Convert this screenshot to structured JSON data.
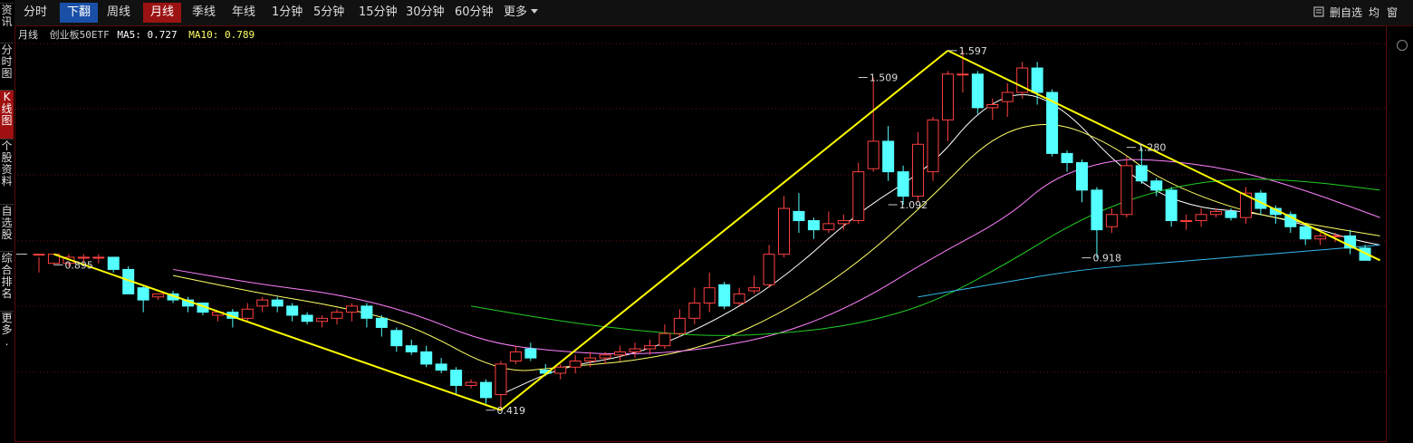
{
  "sidebar": [
    {
      "label": "资讯",
      "active": false
    },
    {
      "label": "分时图",
      "active": false
    },
    {
      "label": "K线图",
      "active": true
    },
    {
      "label": "个股资料",
      "active": false
    },
    {
      "label": "自选股",
      "active": false
    },
    {
      "label": "综合排名",
      "active": false
    },
    {
      "label": "更多.",
      "active": false
    }
  ],
  "tabs": [
    {
      "label": "分时",
      "style": "plain"
    },
    {
      "label": "下翻",
      "style": "blue"
    },
    {
      "label": "周线",
      "style": "plain"
    },
    {
      "label": "月线",
      "style": "red"
    },
    {
      "label": "季线",
      "style": "plain"
    },
    {
      "label": "年线",
      "style": "plain"
    },
    {
      "label": "1分钟",
      "style": "plain"
    },
    {
      "label": "5分钟",
      "style": "plain"
    },
    {
      "label": "15分钟",
      "style": "plain"
    },
    {
      "label": "30分钟",
      "style": "plain"
    },
    {
      "label": "60分钟",
      "style": "plain"
    }
  ],
  "more_label": "更多",
  "right_tools": {
    "delete_label": "删自选",
    "avg_label": "均",
    "window_label": "窗",
    "icon": "square-icon"
  },
  "legend": {
    "period": "月线",
    "name": "创业板50ETF",
    "ma5_label": "MA5: 0.727",
    "ma10_label": "MA10: 0.789"
  },
  "colors": {
    "up": "#ff4040",
    "down": "#54ffff",
    "ma5": "#ffffff",
    "ma10": "#ffff66",
    "ma20": "#ff80ff",
    "ma40": "#22cc22",
    "ma60": "#33bbee",
    "trend": "#ffff00",
    "grid": "#6a1010"
  },
  "chart_data": {
    "type": "candlestick",
    "ylim": [
      0.35,
      1.65
    ],
    "annotations": [
      {
        "text": "0.895",
        "index": 1,
        "value": 0.895
      },
      {
        "text": "0.419",
        "index": 30,
        "value": 0.419
      },
      {
        "text": "1.509",
        "index": 55,
        "value": 1.509
      },
      {
        "text": "1.092",
        "index": 57,
        "value": 1.092
      },
      {
        "text": "1.597",
        "index": 61,
        "value": 1.597
      },
      {
        "text": "0.918",
        "index": 70,
        "value": 0.918
      },
      {
        "text": "1.280",
        "index": 73,
        "value": 1.28
      }
    ],
    "candles": [
      [
        0.93,
        0.93,
        0.92,
        0.87
      ],
      [
        0.9,
        0.93,
        0.93,
        0.895
      ],
      [
        0.9,
        0.92,
        0.93,
        0.89
      ],
      [
        0.92,
        0.92,
        0.93,
        0.9
      ],
      [
        0.92,
        0.92,
        0.93,
        0.9
      ],
      [
        0.92,
        0.88,
        0.92,
        0.87
      ],
      [
        0.88,
        0.8,
        0.89,
        0.8
      ],
      [
        0.82,
        0.78,
        0.83,
        0.74
      ],
      [
        0.79,
        0.8,
        0.8,
        0.78
      ],
      [
        0.8,
        0.78,
        0.81,
        0.77
      ],
      [
        0.78,
        0.76,
        0.79,
        0.74
      ],
      [
        0.77,
        0.74,
        0.77,
        0.73
      ],
      [
        0.73,
        0.74,
        0.74,
        0.71
      ],
      [
        0.74,
        0.72,
        0.75,
        0.69
      ],
      [
        0.72,
        0.75,
        0.77,
        0.71
      ],
      [
        0.76,
        0.78,
        0.79,
        0.74
      ],
      [
        0.78,
        0.76,
        0.79,
        0.74
      ],
      [
        0.76,
        0.73,
        0.77,
        0.71
      ],
      [
        0.73,
        0.71,
        0.74,
        0.7
      ],
      [
        0.71,
        0.72,
        0.73,
        0.69
      ],
      [
        0.72,
        0.74,
        0.75,
        0.7
      ],
      [
        0.74,
        0.76,
        0.77,
        0.71
      ],
      [
        0.76,
        0.72,
        0.77,
        0.69
      ],
      [
        0.72,
        0.69,
        0.73,
        0.66
      ],
      [
        0.68,
        0.63,
        0.69,
        0.61
      ],
      [
        0.63,
        0.61,
        0.65,
        0.6
      ],
      [
        0.61,
        0.57,
        0.63,
        0.56
      ],
      [
        0.57,
        0.55,
        0.59,
        0.54
      ],
      [
        0.55,
        0.5,
        0.56,
        0.47
      ],
      [
        0.5,
        0.51,
        0.52,
        0.49
      ],
      [
        0.51,
        0.46,
        0.52,
        0.44
      ],
      [
        0.47,
        0.57,
        0.58,
        0.419
      ],
      [
        0.58,
        0.61,
        0.63,
        0.57
      ],
      [
        0.62,
        0.59,
        0.64,
        0.58
      ],
      [
        0.55,
        0.54,
        0.57,
        0.53
      ],
      [
        0.54,
        0.56,
        0.57,
        0.52
      ],
      [
        0.56,
        0.58,
        0.6,
        0.54
      ],
      [
        0.58,
        0.59,
        0.61,
        0.56
      ],
      [
        0.59,
        0.6,
        0.61,
        0.57
      ],
      [
        0.6,
        0.61,
        0.63,
        0.58
      ],
      [
        0.61,
        0.62,
        0.64,
        0.59
      ],
      [
        0.62,
        0.63,
        0.65,
        0.6
      ],
      [
        0.63,
        0.67,
        0.7,
        0.62
      ],
      [
        0.67,
        0.72,
        0.75,
        0.66
      ],
      [
        0.72,
        0.77,
        0.82,
        0.7
      ],
      [
        0.77,
        0.82,
        0.87,
        0.74
      ],
      [
        0.83,
        0.76,
        0.84,
        0.75
      ],
      [
        0.77,
        0.8,
        0.82,
        0.76
      ],
      [
        0.81,
        0.82,
        0.86,
        0.8
      ],
      [
        0.83,
        0.93,
        0.96,
        0.82
      ],
      [
        0.93,
        1.08,
        1.12,
        0.92
      ],
      [
        1.07,
        1.04,
        1.13,
        1.0
      ],
      [
        1.04,
        1.01,
        1.05,
        0.98
      ],
      [
        1.01,
        1.03,
        1.07,
        1.0
      ],
      [
        1.03,
        1.04,
        1.06,
        1.01
      ],
      [
        1.04,
        1.2,
        1.23,
        1.03
      ],
      [
        1.21,
        1.3,
        1.509,
        1.2
      ],
      [
        1.3,
        1.2,
        1.35,
        1.17
      ],
      [
        1.2,
        1.12,
        1.22,
        1.092
      ],
      [
        1.12,
        1.29,
        1.33,
        1.1
      ],
      [
        1.2,
        1.37,
        1.38,
        1.17
      ],
      [
        1.37,
        1.52,
        1.53,
        1.3
      ],
      [
        1.52,
        1.52,
        1.597,
        1.46
      ],
      [
        1.52,
        1.41,
        1.53,
        1.39
      ],
      [
        1.41,
        1.42,
        1.44,
        1.37
      ],
      [
        1.43,
        1.46,
        1.49,
        1.38
      ],
      [
        1.46,
        1.54,
        1.56,
        1.44
      ],
      [
        1.54,
        1.46,
        1.56,
        1.42
      ],
      [
        1.46,
        1.26,
        1.47,
        1.25
      ],
      [
        1.26,
        1.23,
        1.27,
        1.2
      ],
      [
        1.23,
        1.14,
        1.24,
        1.1
      ],
      [
        1.14,
        1.01,
        1.15,
        0.918
      ],
      [
        1.02,
        1.06,
        1.08,
        1.0
      ],
      [
        1.06,
        1.22,
        1.25,
        1.05
      ],
      [
        1.22,
        1.17,
        1.28,
        1.16
      ],
      [
        1.17,
        1.14,
        1.18,
        1.12
      ],
      [
        1.14,
        1.04,
        1.15,
        1.02
      ],
      [
        1.04,
        1.04,
        1.06,
        1.01
      ],
      [
        1.04,
        1.06,
        1.08,
        1.02
      ],
      [
        1.06,
        1.07,
        1.08,
        1.05
      ],
      [
        1.07,
        1.05,
        1.08,
        1.04
      ],
      [
        1.05,
        1.13,
        1.15,
        1.03
      ],
      [
        1.13,
        1.08,
        1.14,
        1.06
      ],
      [
        1.08,
        1.06,
        1.09,
        1.03
      ],
      [
        1.06,
        1.02,
        1.07,
        1.0
      ],
      [
        1.02,
        0.98,
        1.03,
        0.96
      ],
      [
        0.98,
        0.99,
        1.0,
        0.96
      ],
      [
        0.99,
        0.99,
        1.0,
        0.97
      ],
      [
        0.99,
        0.95,
        1.01,
        0.93
      ],
      [
        0.95,
        0.91,
        0.96,
        0.91
      ]
    ],
    "ma_lines": [
      {
        "name": "MA5",
        "color": "#ffffff",
        "points": [
          [
            31,
            0.47
          ],
          [
            35,
            0.56
          ],
          [
            40,
            0.6
          ],
          [
            45,
            0.7
          ],
          [
            50,
            0.85
          ],
          [
            55,
            1.07
          ],
          [
            60,
            1.22
          ],
          [
            63,
            1.4
          ],
          [
            66,
            1.47
          ],
          [
            69,
            1.4
          ],
          [
            72,
            1.24
          ],
          [
            75,
            1.13
          ],
          [
            78,
            1.08
          ],
          [
            81,
            1.07
          ],
          [
            84,
            1.04
          ],
          [
            88,
            0.98
          ],
          [
            90,
            0.96
          ]
        ]
      },
      {
        "name": "MA10",
        "color": "#ffff66",
        "points": [
          [
            9,
            0.86
          ],
          [
            15,
            0.8
          ],
          [
            20,
            0.76
          ],
          [
            25,
            0.7
          ],
          [
            31,
            0.54
          ],
          [
            35,
            0.56
          ],
          [
            40,
            0.58
          ],
          [
            45,
            0.63
          ],
          [
            50,
            0.74
          ],
          [
            55,
            0.9
          ],
          [
            60,
            1.12
          ],
          [
            64,
            1.32
          ],
          [
            68,
            1.37
          ],
          [
            72,
            1.29
          ],
          [
            75,
            1.18
          ],
          [
            80,
            1.08
          ],
          [
            85,
            1.03
          ],
          [
            90,
            0.99
          ]
        ]
      },
      {
        "name": "MA20",
        "color": "#ff80ff",
        "points": [
          [
            9,
            0.88
          ],
          [
            15,
            0.83
          ],
          [
            20,
            0.8
          ],
          [
            25,
            0.74
          ],
          [
            30,
            0.64
          ],
          [
            35,
            0.61
          ],
          [
            40,
            0.6
          ],
          [
            45,
            0.62
          ],
          [
            50,
            0.67
          ],
          [
            55,
            0.77
          ],
          [
            60,
            0.92
          ],
          [
            65,
            1.05
          ],
          [
            68,
            1.18
          ],
          [
            72,
            1.24
          ],
          [
            75,
            1.24
          ],
          [
            80,
            1.21
          ],
          [
            85,
            1.14
          ],
          [
            90,
            1.05
          ]
        ]
      },
      {
        "name": "MA40",
        "color": "#22cc22",
        "points": [
          [
            29,
            0.76
          ],
          [
            35,
            0.71
          ],
          [
            40,
            0.68
          ],
          [
            45,
            0.66
          ],
          [
            50,
            0.67
          ],
          [
            55,
            0.7
          ],
          [
            60,
            0.77
          ],
          [
            65,
            0.9
          ],
          [
            70,
            1.05
          ],
          [
            75,
            1.14
          ],
          [
            80,
            1.18
          ],
          [
            85,
            1.17
          ],
          [
            90,
            1.14
          ]
        ]
      },
      {
        "name": "MA60",
        "color": "#33bbee",
        "points": [
          [
            59,
            0.79
          ],
          [
            65,
            0.84
          ],
          [
            70,
            0.88
          ],
          [
            75,
            0.9
          ],
          [
            80,
            0.92
          ],
          [
            85,
            0.94
          ],
          [
            90,
            0.96
          ]
        ]
      }
    ],
    "trend_lines": [
      [
        [
          1,
          0.93
        ],
        [
          31,
          0.419
        ]
      ],
      [
        [
          31,
          0.419
        ],
        [
          61,
          1.597
        ]
      ],
      [
        [
          61,
          1.597
        ],
        [
          90,
          0.91
        ]
      ]
    ]
  }
}
